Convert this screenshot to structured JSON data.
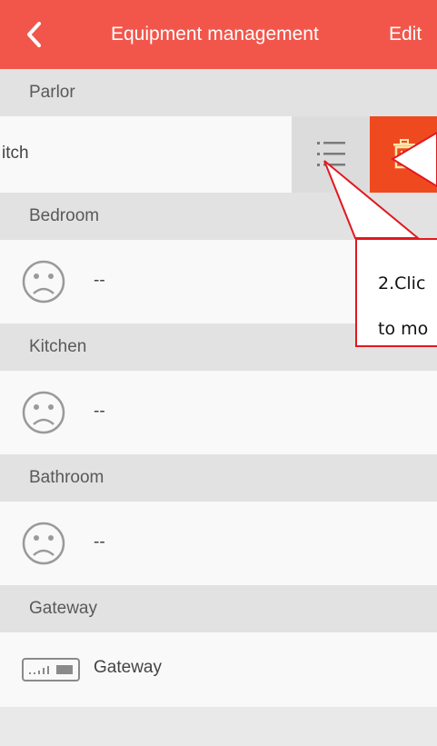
{
  "header": {
    "title": "Equipment management",
    "edit_label": "Edit",
    "back_icon": "chevron-left-icon",
    "background_color": "#f2564b"
  },
  "sections": [
    {
      "name": "Parlor"
    },
    {
      "name": "Bedroom"
    },
    {
      "name": "Kitchen"
    },
    {
      "name": "Bathroom"
    },
    {
      "name": "Gateway"
    }
  ],
  "parlor_row": {
    "label": "itch",
    "menu_icon": "list-icon",
    "delete_icon": "trash-icon",
    "delete_color": "#ef4a1f"
  },
  "bedroom_row": {
    "label": "--",
    "icon": "sad-face-icon"
  },
  "kitchen_row": {
    "label": "--",
    "icon": "sad-face-icon"
  },
  "bathroom_row": {
    "label": "--",
    "icon": "sad-face-icon"
  },
  "gateway_row": {
    "label": "Gateway",
    "icon": "gateway-device-icon"
  },
  "callout": {
    "line1": "2.Clic",
    "line2": "to mo",
    "border_color": "#e2181f"
  }
}
